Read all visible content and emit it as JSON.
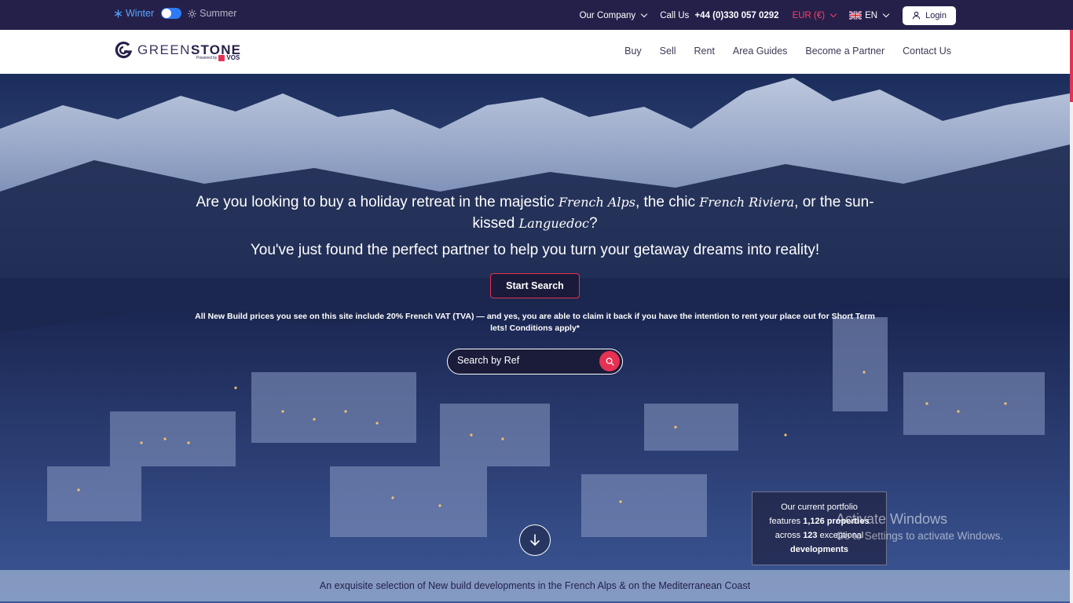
{
  "topbar": {
    "winter_label": "Winter",
    "summer_label": "Summer",
    "company_label": "Our Company",
    "call_prefix": "Call Us ",
    "phone": "+44 (0)330 057 0292",
    "currency": "EUR (€)",
    "language": "EN",
    "login_label": "Login"
  },
  "navbar": {
    "logo_part1": "GREEN",
    "logo_part2": "STONE",
    "logo_powered": "Powered by",
    "logo_vos": "VOS",
    "links": [
      "Buy",
      "Sell",
      "Rent",
      "Area Guides",
      "Become a Partner",
      "Contact Us"
    ]
  },
  "hero": {
    "headline_1": "Are you looking to buy a holiday retreat in the majestic ",
    "place_1": "French Alps",
    "headline_2": ", the chic ",
    "place_2": "French Riviera",
    "headline_3": ", or the sun-kissed ",
    "place_3": "Languedoc",
    "headline_4": "?",
    "subheadline": "You've just found the perfect partner to help you turn your getaway dreams into reality!",
    "start_search_label": "Start Search",
    "vat_notice": "All New Build prices you see on this site include 20% French VAT (TVA) — and yes, you are able to claim it back if you have the intention to rent your place out for Short Term lets! Conditions apply*",
    "search_placeholder": "Search by Ref",
    "bottom_strip": "An exquisite selection of New build developments in the French Alps & on the Mediterranean Coast"
  },
  "portfolio": {
    "line1": "Our current portfolio",
    "line2_prefix": "features ",
    "properties": "1,126 properties",
    "line3_prefix": "across ",
    "developments_count": "123",
    "line3_suffix": " exceptional",
    "developments_label": "developments"
  },
  "watermark": {
    "title": "Activate Windows",
    "subtitle": "Go to Settings to activate Windows."
  },
  "colors": {
    "brand_dark": "#25204a",
    "accent": "#e63153",
    "toggle_blue": "#2f7bf5"
  }
}
